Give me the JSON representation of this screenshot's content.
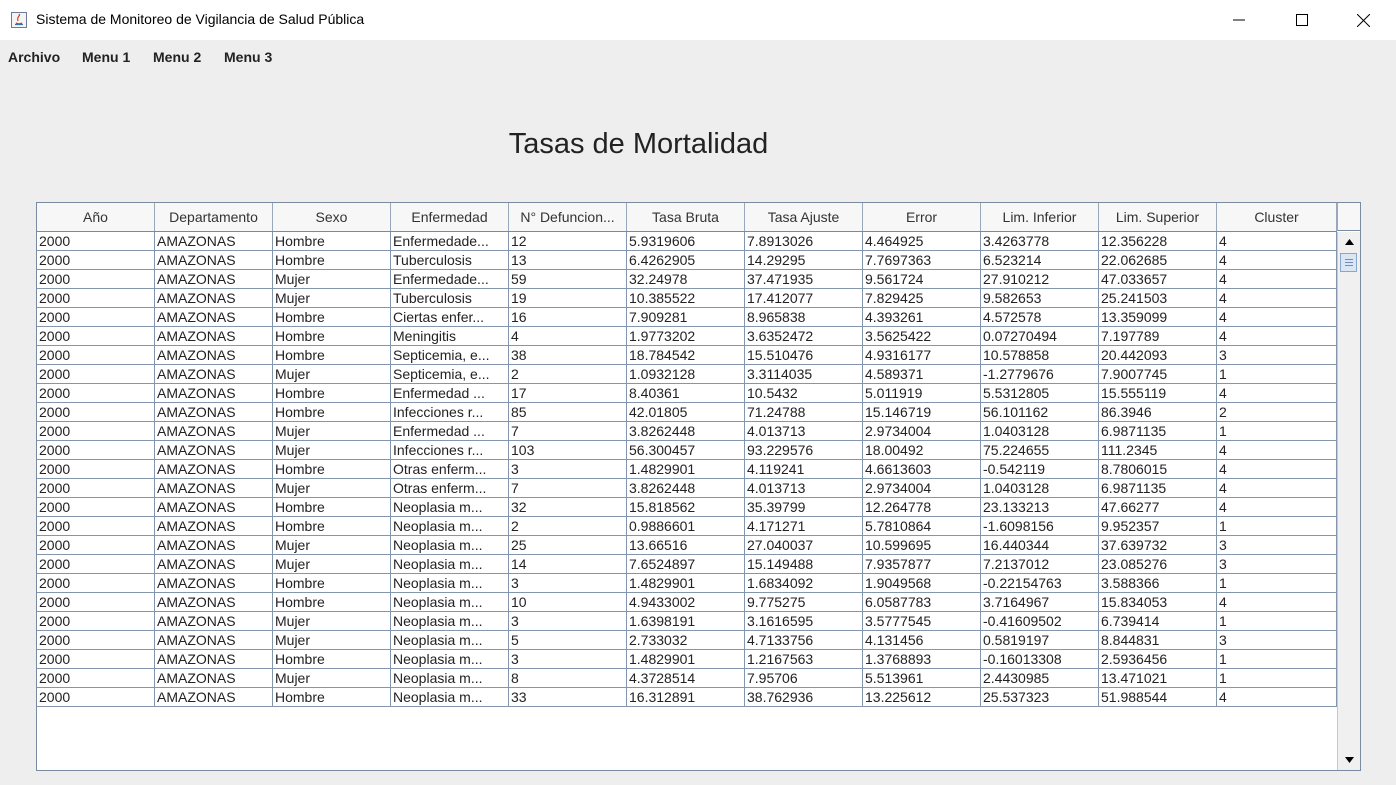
{
  "window": {
    "title": "Sistema de Monitoreo de Vigilancia de Salud Pública"
  },
  "menubar": {
    "items": [
      "Archivo",
      "Menu 1",
      "Menu 2",
      "Menu 3"
    ]
  },
  "page": {
    "title": "Tasas de Mortalidad"
  },
  "table": {
    "columns": [
      "Año",
      "Departamento",
      "Sexo",
      "Enfermedad",
      "N° Defuncion...",
      "Tasa Bruta",
      "Tasa Ajuste",
      "Error",
      "Lim. Inferior",
      "Lim. Superior",
      "Cluster"
    ],
    "rows": [
      [
        "2000",
        "AMAZONAS",
        "Hombre",
        "Enfermedade...",
        "12",
        "5.9319606",
        "7.8913026",
        "4.464925",
        "3.4263778",
        "12.356228",
        "4"
      ],
      [
        "2000",
        "AMAZONAS",
        "Hombre",
        "Tuberculosis",
        "13",
        "6.4262905",
        "14.29295",
        "7.7697363",
        "6.523214",
        "22.062685",
        "4"
      ],
      [
        "2000",
        "AMAZONAS",
        "Mujer",
        "Enfermedade...",
        "59",
        "32.24978",
        "37.471935",
        "9.561724",
        "27.910212",
        "47.033657",
        "4"
      ],
      [
        "2000",
        "AMAZONAS",
        "Mujer",
        "Tuberculosis",
        "19",
        "10.385522",
        "17.412077",
        "7.829425",
        "9.582653",
        "25.241503",
        "4"
      ],
      [
        "2000",
        "AMAZONAS",
        "Hombre",
        "Ciertas enfer...",
        "16",
        "7.909281",
        "8.965838",
        "4.393261",
        "4.572578",
        "13.359099",
        "4"
      ],
      [
        "2000",
        "AMAZONAS",
        "Hombre",
        "Meningitis",
        "4",
        "1.9773202",
        "3.6352472",
        "3.5625422",
        "0.07270494",
        "7.197789",
        "4"
      ],
      [
        "2000",
        "AMAZONAS",
        "Hombre",
        "Septicemia, e...",
        "38",
        "18.784542",
        "15.510476",
        "4.9316177",
        "10.578858",
        "20.442093",
        "3"
      ],
      [
        "2000",
        "AMAZONAS",
        "Mujer",
        "Septicemia, e...",
        "2",
        "1.0932128",
        "3.3114035",
        "4.589371",
        "-1.2779676",
        "7.9007745",
        "1"
      ],
      [
        "2000",
        "AMAZONAS",
        "Hombre",
        "Enfermedad ...",
        "17",
        "8.40361",
        "10.5432",
        "5.011919",
        "5.5312805",
        "15.555119",
        "4"
      ],
      [
        "2000",
        "AMAZONAS",
        "Hombre",
        "Infecciones r...",
        "85",
        "42.01805",
        "71.24788",
        "15.146719",
        "56.101162",
        "86.3946",
        "2"
      ],
      [
        "2000",
        "AMAZONAS",
        "Mujer",
        "Enfermedad ...",
        "7",
        "3.8262448",
        "4.013713",
        "2.9734004",
        "1.0403128",
        "6.9871135",
        "1"
      ],
      [
        "2000",
        "AMAZONAS",
        "Mujer",
        "Infecciones r...",
        "103",
        "56.300457",
        "93.229576",
        "18.00492",
        "75.224655",
        "111.2345",
        "4"
      ],
      [
        "2000",
        "AMAZONAS",
        "Hombre",
        "Otras enferm...",
        "3",
        "1.4829901",
        "4.119241",
        "4.6613603",
        "-0.542119",
        "8.7806015",
        "4"
      ],
      [
        "2000",
        "AMAZONAS",
        "Mujer",
        "Otras enferm...",
        "7",
        "3.8262448",
        "4.013713",
        "2.9734004",
        "1.0403128",
        "6.9871135",
        "4"
      ],
      [
        "2000",
        "AMAZONAS",
        "Hombre",
        "Neoplasia m...",
        "32",
        "15.818562",
        "35.39799",
        "12.264778",
        "23.133213",
        "47.66277",
        "4"
      ],
      [
        "2000",
        "AMAZONAS",
        "Hombre",
        "Neoplasia m...",
        "2",
        "0.9886601",
        "4.171271",
        "5.7810864",
        "-1.6098156",
        "9.952357",
        "1"
      ],
      [
        "2000",
        "AMAZONAS",
        "Mujer",
        "Neoplasia m...",
        "25",
        "13.66516",
        "27.040037",
        "10.599695",
        "16.440344",
        "37.639732",
        "3"
      ],
      [
        "2000",
        "AMAZONAS",
        "Mujer",
        "Neoplasia m...",
        "14",
        "7.6524897",
        "15.149488",
        "7.9357877",
        "7.2137012",
        "23.085276",
        "3"
      ],
      [
        "2000",
        "AMAZONAS",
        "Hombre",
        "Neoplasia m...",
        "3",
        "1.4829901",
        "1.6834092",
        "1.9049568",
        "-0.22154763",
        "3.588366",
        "1"
      ],
      [
        "2000",
        "AMAZONAS",
        "Hombre",
        "Neoplasia m...",
        "10",
        "4.9433002",
        "9.775275",
        "6.0587783",
        "3.7164967",
        "15.834053",
        "4"
      ],
      [
        "2000",
        "AMAZONAS",
        "Mujer",
        "Neoplasia m...",
        "3",
        "1.6398191",
        "3.1616595",
        "3.5777545",
        "-0.41609502",
        "6.739414",
        "1"
      ],
      [
        "2000",
        "AMAZONAS",
        "Mujer",
        "Neoplasia m...",
        "5",
        "2.733032",
        "4.7133756",
        "4.131456",
        "0.5819197",
        "8.844831",
        "3"
      ],
      [
        "2000",
        "AMAZONAS",
        "Hombre",
        "Neoplasia m...",
        "3",
        "1.4829901",
        "1.2167563",
        "1.3768893",
        "-0.16013308",
        "2.5936456",
        "1"
      ],
      [
        "2000",
        "AMAZONAS",
        "Mujer",
        "Neoplasia m...",
        "8",
        "4.3728514",
        "7.95706",
        "5.513961",
        "2.4430985",
        "13.471021",
        "1"
      ],
      [
        "2000",
        "AMAZONAS",
        "Hombre",
        "Neoplasia m...",
        "33",
        "16.312891",
        "38.762936",
        "13.225612",
        "25.537323",
        "51.988544",
        "4"
      ]
    ]
  },
  "scrollbar": {
    "up_icon": "arrow-up-icon",
    "down_icon": "arrow-down-icon",
    "position": 0.0
  }
}
